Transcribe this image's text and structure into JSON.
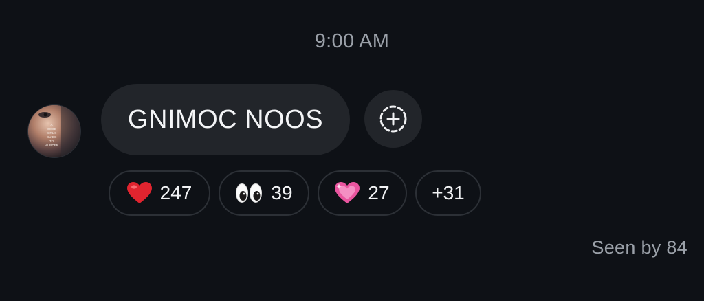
{
  "timestamp": "9:00 AM",
  "avatar": {
    "cover_text": [
      "A",
      "GOOD",
      "GIRL'S",
      "GUIDE",
      "TO",
      "MURDER"
    ]
  },
  "message": {
    "text": "GNIMOC NOOS"
  },
  "add_reaction_icon": "add-reaction-dashed-plus-icon",
  "reactions": [
    {
      "emoji": "heart-red-icon",
      "count": "247"
    },
    {
      "emoji": "eyes-icon",
      "count": "39"
    },
    {
      "emoji": "heart-pink-sparkle-icon",
      "count": "27"
    }
  ],
  "more_reactions": "+31",
  "seen": "Seen by 84",
  "colors": {
    "background": "#0e1116",
    "bubble": "#22252a",
    "muted_text": "#9aa0a8",
    "heart_red": "#e0242f",
    "heart_pink": "#e9559f"
  }
}
